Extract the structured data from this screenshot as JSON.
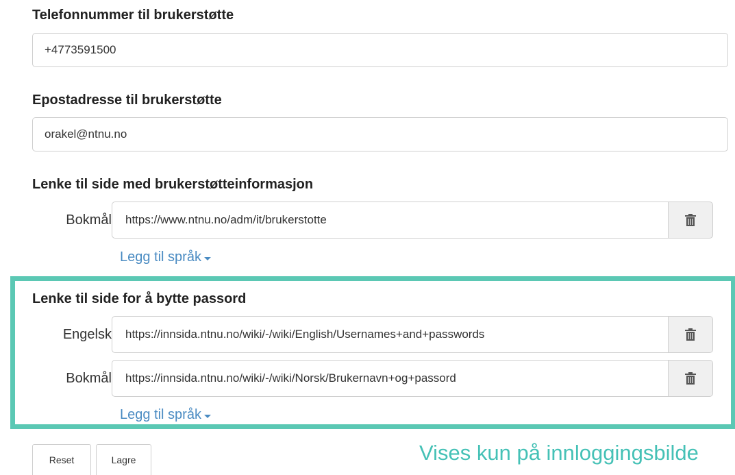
{
  "phone": {
    "label": "Telefonnummer til brukerstøtte",
    "value": "+4773591500"
  },
  "email": {
    "label": "Epostadresse til brukerstøtte",
    "value": "orakel@ntnu.no"
  },
  "support_link": {
    "label": "Lenke til side med brukerstøtteinformasjon",
    "rows": [
      {
        "lang": "Bokmål",
        "url": "https://www.ntnu.no/adm/it/brukerstotte"
      }
    ],
    "add_language": "Legg til språk"
  },
  "password_link": {
    "label": "Lenke til side for å bytte passord",
    "rows": [
      {
        "lang": "Engelsk",
        "url": "https://innsida.ntnu.no/wiki/-/wiki/English/Usernames+and+passwords"
      },
      {
        "lang": "Bokmål",
        "url": "https://innsida.ntnu.no/wiki/-/wiki/Norsk/Brukernavn+og+passord"
      }
    ],
    "add_language": "Legg til språk"
  },
  "buttons": {
    "reset": "Reset",
    "save": "Lagre"
  },
  "annotation": "Vises kun på innloggingsbilde",
  "colors": {
    "highlight": "#5bc8b4",
    "annotation": "#45c1b6",
    "link": "#4a8bc2"
  }
}
